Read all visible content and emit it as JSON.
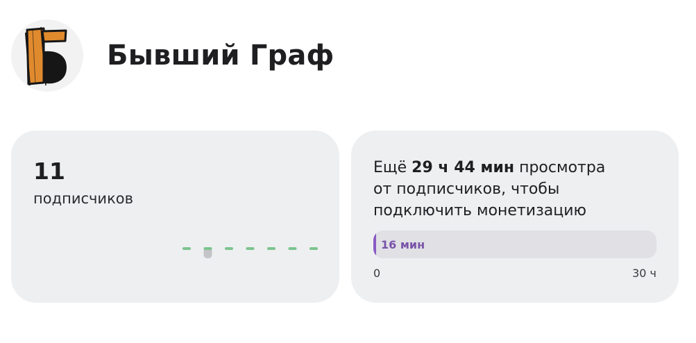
{
  "channel": {
    "name": "Бывший Граф",
    "logo_icon": "channel-logo-b-icon",
    "logo_colors": {
      "orange": "#e08a2e",
      "black": "#161616"
    }
  },
  "subscribers": {
    "count": "11",
    "label": "подписчиков",
    "sparkline": {
      "points": 7,
      "highlight_index": 1,
      "color": "#7cc48f",
      "highlight_color": "#c4c4c8"
    }
  },
  "monetization": {
    "text_prefix": "Ещё ",
    "remaining": "29 ч 44 мин",
    "text_suffix_line1": " просмотра",
    "text_line2": "от подписчиков, чтобы",
    "text_line3": "подключить монетизацию",
    "progress": {
      "label": "16 мин",
      "fraction": 0.0089,
      "min_label": "0",
      "max_label": "30 ч",
      "fill_color": "#8a5bc5"
    }
  }
}
